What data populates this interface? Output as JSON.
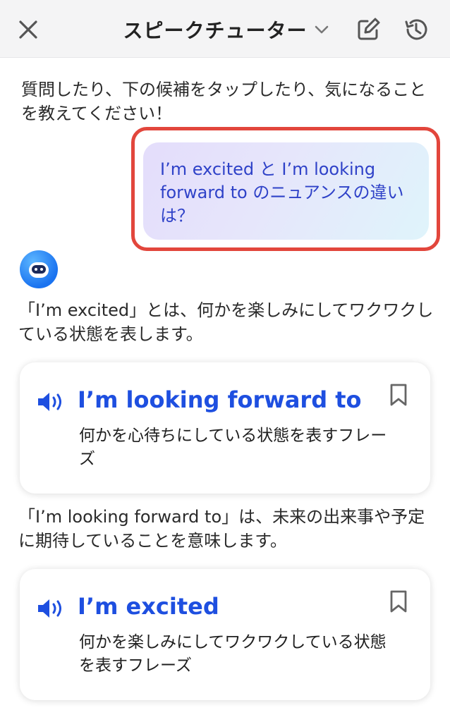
{
  "header": {
    "title": "スピークチューター",
    "icons": {
      "close": "close-icon",
      "dropdown": "chevron-down-icon",
      "edit": "edit-icon",
      "history": "history-icon"
    }
  },
  "intro": {
    "text": "質問したり、下の候補をタップしたり、気になることを教えてください！"
  },
  "user_message": {
    "text": "I’m excited と I’m looking forward to のニュアンスの違いは？",
    "highlight_color": "#e2463c"
  },
  "bot": {
    "avatar_icon": "tutor-avatar-icon",
    "message_1": "「I’m excited」とは、何かを楽しみにしてワクワクしている状態を表します。",
    "card_1": {
      "phrase": "I’m looking forward to",
      "description": "何かを心待ちにしている状態を表すフレーズ"
    },
    "message_2": "「I’m looking forward to」は、未来の出来事や予定に期待していることを意味します。",
    "card_2": {
      "phrase": "I’m excited",
      "description": "何かを楽しみにしてワクワクしている状態を表すフレーズ"
    }
  },
  "colors": {
    "accent_blue": "#1e4fe0",
    "user_text": "#2f42c8",
    "header_bg": "#f4f4f5"
  }
}
